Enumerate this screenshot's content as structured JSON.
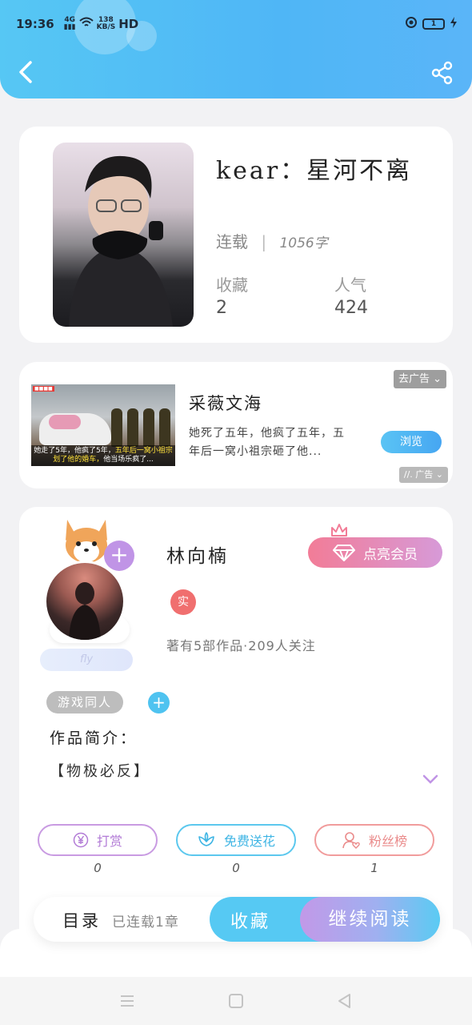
{
  "status_bar": {
    "time": "19:36",
    "signal": "4G",
    "net_speed_value": "138",
    "net_speed_unit": "KB/S",
    "hd": "HD",
    "battery": "1"
  },
  "book": {
    "title": "kear：星河不离",
    "status": "连载",
    "word_count": "1056字",
    "favorites_label": "收藏",
    "favorites": "2",
    "popularity_label": "人气",
    "popularity": "424"
  },
  "ad": {
    "title": "采薇文海",
    "description": "她死了五年，他疯了五年，五年后一窝小祖宗砸了他...",
    "cta": "浏览",
    "close_label": "去广告",
    "badge": "广告",
    "image_caption_line1": "她走了5年，他疯了5年，",
    "image_caption_line1_highlight": "五年后一窝小祖宗",
    "image_caption_line2_highlight": "划了他的婚车，",
    "image_caption_line2": "他当场乐疯了..."
  },
  "author": {
    "name": "林向楠",
    "verified_badge": "实",
    "summary": "著有5部作品·209人关注",
    "vip_button": "点亮会员",
    "fly_label": "fly",
    "tag": "游戏同人",
    "intro_label": "作品简介：",
    "intro_text": "【物极必反】"
  },
  "actions": [
    {
      "label": "打赏",
      "count": "0",
      "color": "#b27bd6"
    },
    {
      "label": "免费送花",
      "count": "0",
      "color": "#3fb5e4"
    },
    {
      "label": "粉丝榜",
      "count": "1",
      "color": "#ea8b8b"
    }
  ],
  "bottom_bar": {
    "toc_label": "目录",
    "toc_status": "已连载1章",
    "favorite_button": "收藏",
    "read_button": "继续阅读"
  },
  "colors": {
    "header": "#4fb6f6",
    "accent_blue": "#56c9f3",
    "accent_purple": "#c094e6",
    "accent_pink": "#f27c97"
  },
  "icons": [
    "back-icon",
    "share-icon",
    "plus-icon",
    "diamond-icon",
    "crown-icon",
    "yuan-icon",
    "flower-icon",
    "user-heart-icon",
    "chevron-down-icon",
    "menu-icon",
    "home-icon",
    "back-triangle-icon"
  ]
}
